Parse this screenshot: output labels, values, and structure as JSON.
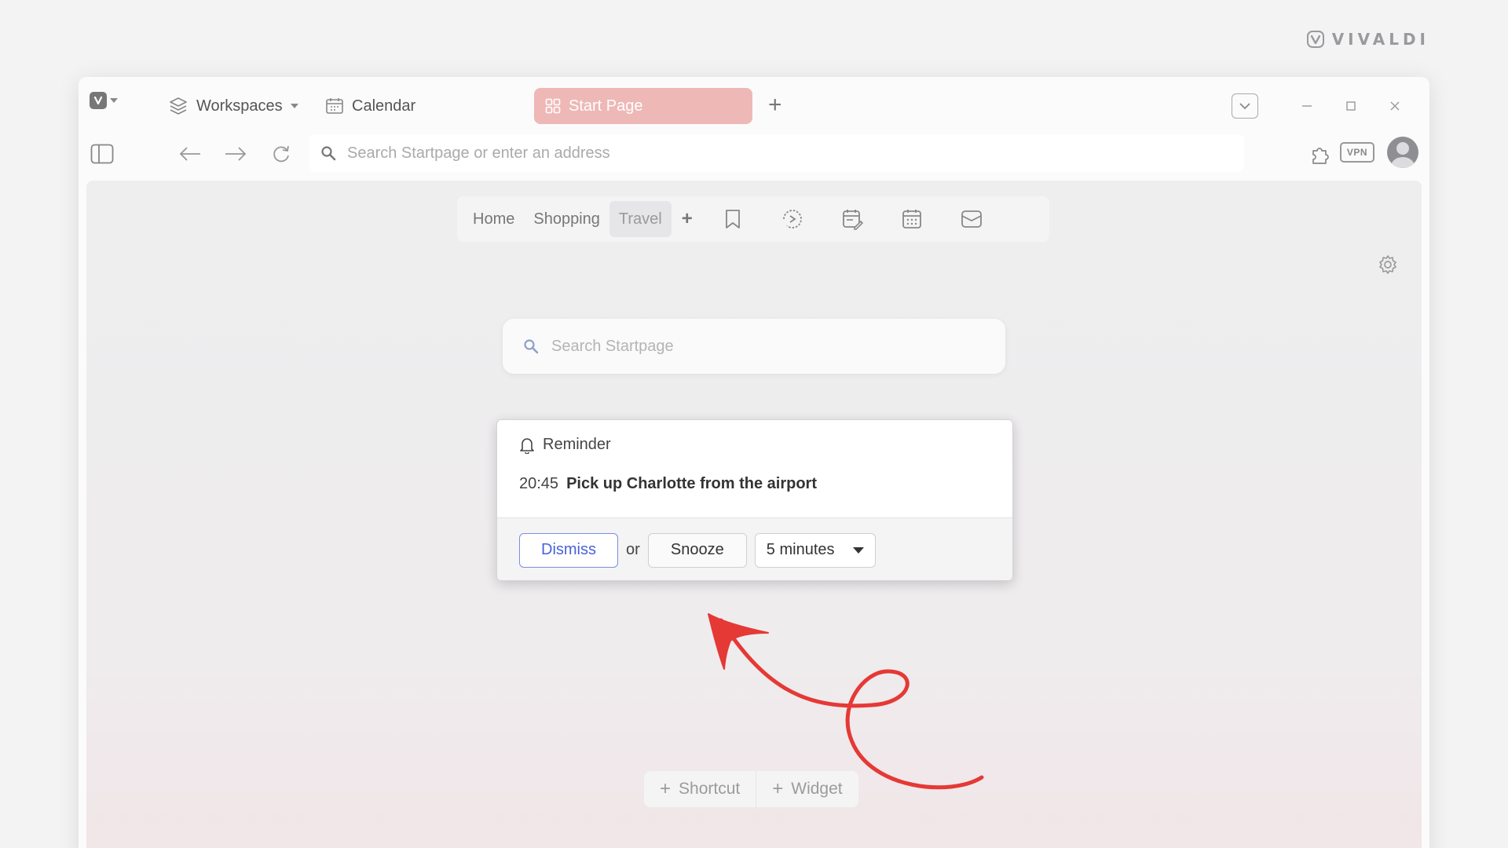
{
  "brand": {
    "name": "VIVALDI"
  },
  "tabs": {
    "workspaces": "Workspaces",
    "calendar": "Calendar",
    "active": "Start Page"
  },
  "address_bar": {
    "placeholder": "Search Startpage or enter an address"
  },
  "toolbar": {
    "vpn": "VPN"
  },
  "start_page": {
    "nav": [
      "Home",
      "Shopping",
      "Travel"
    ],
    "selected_nav": "Travel",
    "search_placeholder": "Search Startpage",
    "shortcut": "Shortcut",
    "widget": "Widget"
  },
  "reminder": {
    "title": "Reminder",
    "time": "20:45",
    "text": "Pick up Charlotte from the airport",
    "dismiss": "Dismiss",
    "or": "or",
    "snooze": "Snooze",
    "snooze_interval": "5 minutes"
  },
  "colors": {
    "active_tab": "#eeb8b6",
    "dismiss_accent": "#4a62d8",
    "annotation_arrow": "#e53935"
  }
}
